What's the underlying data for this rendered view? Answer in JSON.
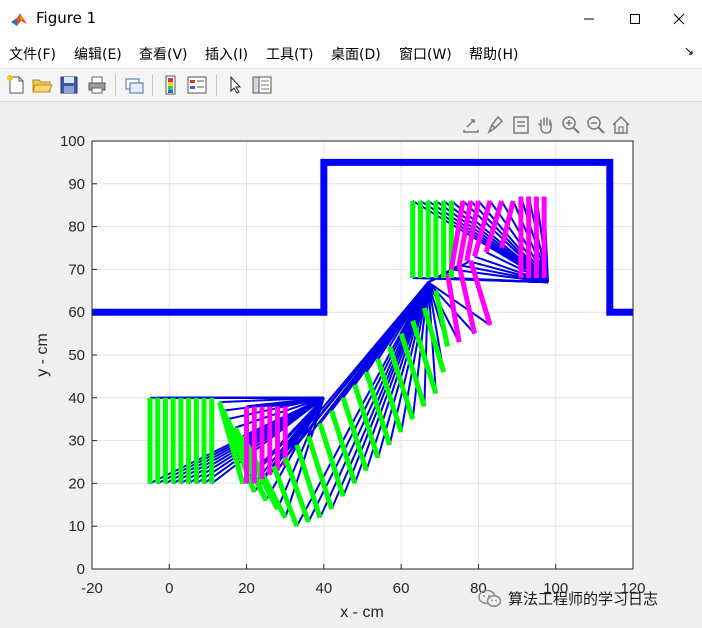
{
  "window": {
    "title": "Figure 1",
    "minimize_icon": "minimize-icon",
    "maximize_icon": "maximize-icon",
    "close_icon": "close-icon"
  },
  "menu": [
    {
      "label": "文件(F)"
    },
    {
      "label": "编辑(E)"
    },
    {
      "label": "查看(V)"
    },
    {
      "label": "插入(I)"
    },
    {
      "label": "工具(T)"
    },
    {
      "label": "桌面(D)"
    },
    {
      "label": "窗口(W)"
    },
    {
      "label": "帮助(H)"
    }
  ],
  "toolbar": {
    "icons": [
      "new-figure-icon",
      "open-file-icon",
      "save-icon",
      "print-icon",
      "link-plot-icon",
      "insert-colorbar-icon",
      "insert-legend-icon",
      "pointer-icon",
      "property-inspector-icon"
    ]
  },
  "axes_toolbar": {
    "icons": [
      "export-icon",
      "brush-icon",
      "data-tips-icon",
      "pan-hand-icon",
      "zoom-in-icon",
      "zoom-out-icon",
      "restore-view-icon"
    ]
  },
  "watermark": {
    "text": "算法工程师的学习日志",
    "icon": "wechat-icon"
  },
  "chart_data": {
    "type": "line",
    "title": "",
    "xlabel": "x - cm",
    "ylabel": "y - cm",
    "xlim": [
      -20,
      120
    ],
    "ylim": [
      0,
      100
    ],
    "xticks": [
      -20,
      0,
      20,
      40,
      60,
      80,
      100,
      120
    ],
    "yticks": [
      0,
      10,
      20,
      30,
      40,
      50,
      60,
      70,
      80,
      90,
      100
    ],
    "grid": true,
    "colors": {
      "obstacle": "#0000ff",
      "link1": "#0000e6",
      "link2_start": "#00ff00",
      "link2_end": "#ff00ff"
    },
    "obstacle": {
      "x": [
        -20,
        40,
        40,
        114,
        114,
        120
      ],
      "y": [
        60,
        60,
        95,
        95,
        60,
        60
      ]
    },
    "segments": [
      {
        "pivot": [
          40,
          40
        ],
        "poses": [
          {
            "tip": [
              -5,
              40
            ],
            "end": [
              -5,
              20
            ],
            "color": "green"
          },
          {
            "tip": [
              -3,
              40
            ],
            "end": [
              -3,
              20
            ],
            "color": "green"
          },
          {
            "tip": [
              -1,
              40
            ],
            "end": [
              -1,
              20
            ],
            "color": "green"
          },
          {
            "tip": [
              1,
              40
            ],
            "end": [
              1,
              20
            ],
            "color": "green"
          },
          {
            "tip": [
              3,
              40
            ],
            "end": [
              3,
              20
            ],
            "color": "green"
          },
          {
            "tip": [
              5,
              40
            ],
            "end": [
              5,
              20
            ],
            "color": "green"
          },
          {
            "tip": [
              7,
              40
            ],
            "end": [
              7,
              20
            ],
            "color": "green"
          },
          {
            "tip": [
              9,
              40
            ],
            "end": [
              9,
              20
            ],
            "color": "green"
          },
          {
            "tip": [
              11,
              40
            ],
            "end": [
              11,
              20
            ],
            "color": "green"
          },
          {
            "tip": [
              13,
              39
            ],
            "end": [
              19,
              20
            ],
            "color": "green"
          },
          {
            "tip": [
              14,
              37
            ],
            "end": [
              22,
              18
            ],
            "color": "green"
          },
          {
            "tip": [
              15,
              35
            ],
            "end": [
              25,
              16
            ],
            "color": "green"
          },
          {
            "tip": [
              17,
              33
            ],
            "end": [
              28,
              14
            ],
            "color": "green"
          },
          {
            "tip": [
              19,
              31
            ],
            "end": [
              30,
              12
            ],
            "color": "green"
          },
          {
            "tip": [
              20,
              38
            ],
            "end": [
              20,
              20
            ],
            "color": "magenta"
          },
          {
            "tip": [
              22,
              38
            ],
            "end": [
              22,
              20
            ],
            "color": "magenta"
          },
          {
            "tip": [
              24,
              38
            ],
            "end": [
              24,
              21
            ],
            "color": "magenta"
          },
          {
            "tip": [
              26,
              38
            ],
            "end": [
              26,
              22
            ],
            "color": "magenta"
          },
          {
            "tip": [
              28,
              38
            ],
            "end": [
              28,
              23
            ],
            "color": "magenta"
          },
          {
            "tip": [
              30,
              38
            ],
            "end": [
              30,
              24
            ],
            "color": "magenta"
          }
        ]
      },
      {
        "pivot": [
          67,
          67
        ],
        "poses": [
          {
            "tip": [
              27,
              24
            ],
            "end": [
              33,
              10
            ],
            "color": "green"
          },
          {
            "tip": [
              30,
              26
            ],
            "end": [
              36,
              11
            ],
            "color": "green"
          },
          {
            "tip": [
              33,
              29
            ],
            "end": [
              39,
              12
            ],
            "color": "green"
          },
          {
            "tip": [
              36,
              31
            ],
            "end": [
              42,
              14
            ],
            "color": "green"
          },
          {
            "tip": [
              39,
              34
            ],
            "end": [
              45,
              17
            ],
            "color": "green"
          },
          {
            "tip": [
              42,
              37
            ],
            "end": [
              48,
              20
            ],
            "color": "green"
          },
          {
            "tip": [
              45,
              40
            ],
            "end": [
              51,
              23
            ],
            "color": "green"
          },
          {
            "tip": [
              48,
              43
            ],
            "end": [
              54,
              26
            ],
            "color": "green"
          },
          {
            "tip": [
              51,
              46
            ],
            "end": [
              57,
              29
            ],
            "color": "green"
          },
          {
            "tip": [
              54,
              49
            ],
            "end": [
              60,
              32
            ],
            "color": "green"
          },
          {
            "tip": [
              57,
              52
            ],
            "end": [
              63,
              35
            ],
            "color": "green"
          },
          {
            "tip": [
              60,
              55
            ],
            "end": [
              66,
              38
            ],
            "color": "green"
          },
          {
            "tip": [
              63,
              58
            ],
            "end": [
              69,
              41
            ],
            "color": "green"
          },
          {
            "tip": [
              66,
              61
            ],
            "end": [
              71,
              46
            ],
            "color": "green"
          },
          {
            "tip": [
              69,
              65
            ],
            "end": [
              72,
              52
            ],
            "color": "green"
          },
          {
            "tip": [
              72,
              69
            ],
            "end": [
              75,
              53
            ],
            "color": "magenta"
          },
          {
            "tip": [
              75,
              71
            ],
            "end": [
              79,
              55
            ],
            "color": "magenta"
          },
          {
            "tip": [
              78,
              72
            ],
            "end": [
              83,
              57
            ],
            "color": "magenta"
          }
        ]
      },
      {
        "pivot": [
          98,
          67
        ],
        "poses": [
          {
            "tip": [
              63,
              86
            ],
            "end": [
              63,
              68
            ],
            "color": "green"
          },
          {
            "tip": [
              65,
              86
            ],
            "end": [
              65,
              68
            ],
            "color": "green"
          },
          {
            "tip": [
              67,
              86
            ],
            "end": [
              67,
              68
            ],
            "color": "green"
          },
          {
            "tip": [
              69,
              86
            ],
            "end": [
              69,
              68
            ],
            "color": "green"
          },
          {
            "tip": [
              71,
              86
            ],
            "end": [
              71,
              68
            ],
            "color": "green"
          },
          {
            "tip": [
              73,
              86
            ],
            "end": [
              73,
              68
            ],
            "color": "green"
          },
          {
            "tip": [
              76,
              86
            ],
            "end": [
              73,
              70
            ],
            "color": "magenta"
          },
          {
            "tip": [
              78,
              86
            ],
            "end": [
              75,
              71
            ],
            "color": "magenta"
          },
          {
            "tip": [
              80,
              86
            ],
            "end": [
              77,
              72
            ],
            "color": "magenta"
          },
          {
            "tip": [
              83,
              86
            ],
            "end": [
              79,
              73
            ],
            "color": "magenta"
          },
          {
            "tip": [
              86,
              86
            ],
            "end": [
              82,
              74
            ],
            "color": "magenta"
          },
          {
            "tip": [
              89,
              86
            ],
            "end": [
              86,
              75
            ],
            "color": "magenta"
          },
          {
            "tip": [
              91,
              87
            ],
            "end": [
              91,
              68
            ],
            "color": "magenta"
          },
          {
            "tip": [
              93,
              87
            ],
            "end": [
              93,
              68
            ],
            "color": "magenta"
          },
          {
            "tip": [
              95,
              87
            ],
            "end": [
              95,
              68
            ],
            "color": "magenta"
          },
          {
            "tip": [
              97,
              87
            ],
            "end": [
              97,
              68
            ],
            "color": "magenta"
          }
        ]
      }
    ]
  }
}
